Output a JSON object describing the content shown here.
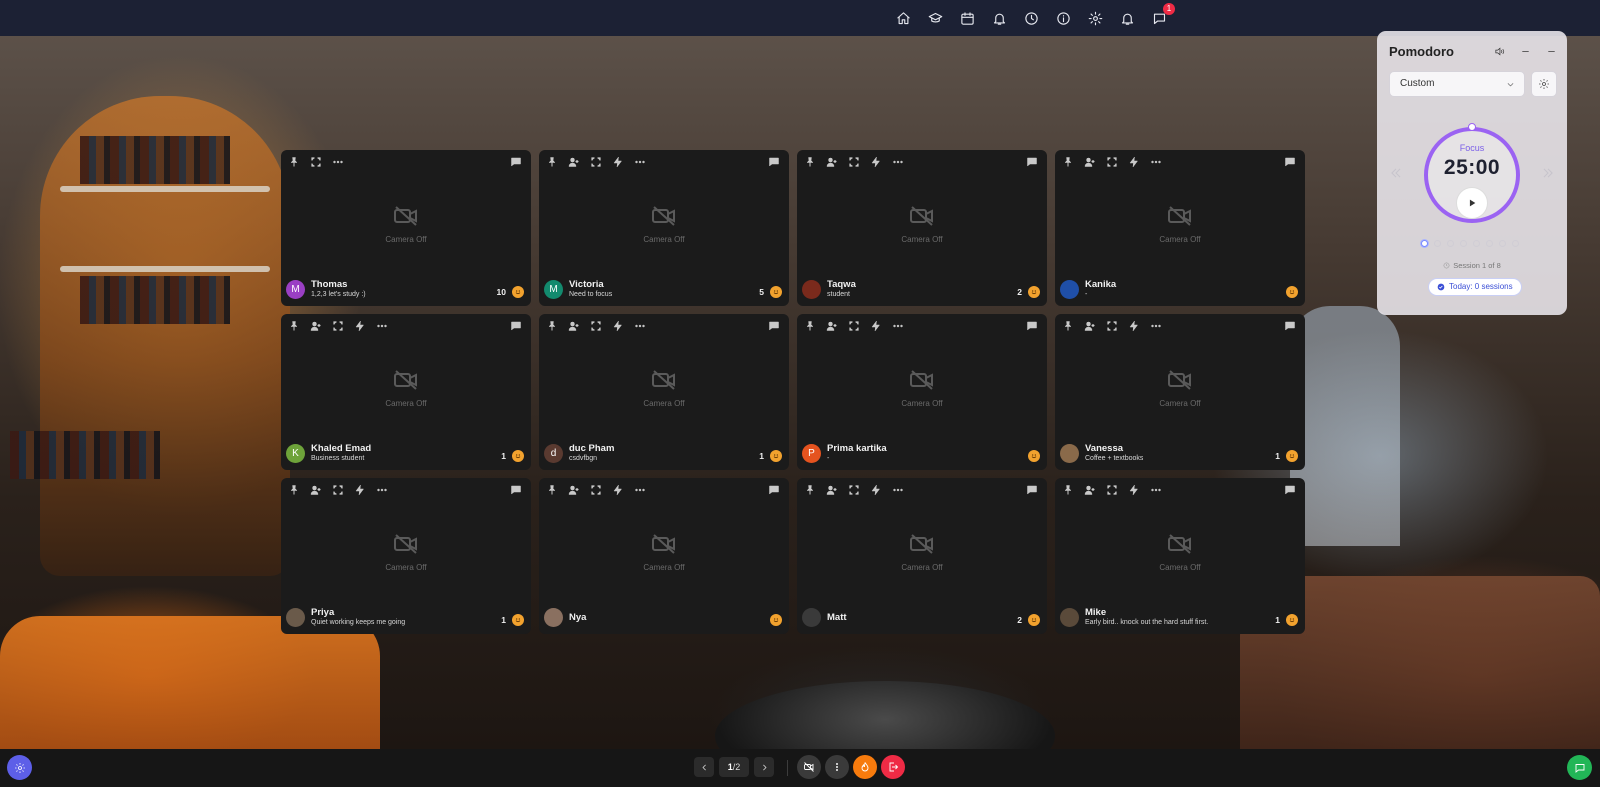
{
  "colors": {
    "topbar": "#1c2134",
    "accent_purple": "#9b63f2",
    "badge_red": "#ef2b45",
    "settings_blue": "#5d5fe8",
    "chat_green": "#22b657",
    "reaction_orange": "#f2a22e",
    "leave_red": "#ef2b45",
    "camera_orange": "#f77b0d"
  },
  "topnav": {
    "icons": [
      "home-icon",
      "graduation-cap-icon",
      "calendar-icon",
      "bell-alarm-icon",
      "clock-icon",
      "info-icon",
      "gear-icon",
      "notification-bell-icon",
      "chat-bubble-icon"
    ],
    "chat_badge": "1"
  },
  "camera_off_label": "Camera Off",
  "tiles": [
    {
      "name": "Thomas",
      "status": "1,2,3 let's study :)",
      "count": "10",
      "avatar_letter": "M",
      "avatar_color": "#9a3fc4",
      "show_add": false
    },
    {
      "name": "Victoria",
      "status": "Need to focus",
      "count": "5",
      "avatar_letter": "M",
      "avatar_color": "#138a6e",
      "show_add": true
    },
    {
      "name": "Taqwa",
      "status": "student",
      "count": "2",
      "avatar_letter": "",
      "avatar_color": "#7a2a1c",
      "show_add": true
    },
    {
      "name": "Kanika",
      "status": "-",
      "count": "",
      "avatar_letter": "",
      "avatar_color": "#1f4fa8",
      "show_add": true
    },
    {
      "name": "Khaled Emad",
      "status": "Business student",
      "count": "1",
      "avatar_letter": "K",
      "avatar_color": "#6ea33a",
      "show_add": true
    },
    {
      "name": "duc Pham",
      "status": "csdvfbgn",
      "count": "1",
      "avatar_letter": "d",
      "avatar_color": "#5a3a30",
      "show_add": true
    },
    {
      "name": "Prima kartika",
      "status": "-",
      "count": "",
      "avatar_letter": "P",
      "avatar_color": "#e5531f",
      "show_add": true
    },
    {
      "name": "Vanessa",
      "status": "Coffee + textbooks",
      "count": "1",
      "avatar_letter": "",
      "avatar_color": "#8a6a4a",
      "show_add": true
    },
    {
      "name": "Priya",
      "status": "Quiet working keeps me going",
      "count": "1",
      "avatar_letter": "",
      "avatar_color": "#6a5a4a",
      "show_add": true
    },
    {
      "name": "Nya",
      "status": "",
      "count": "",
      "avatar_letter": "",
      "avatar_color": "#8a7060",
      "show_add": true
    },
    {
      "name": "Matt",
      "status": "",
      "count": "2",
      "avatar_letter": "",
      "avatar_color": "#3a3a3a",
      "show_add": true
    },
    {
      "name": "Mike",
      "status": "Early bird.. knock out the hard stuff first.",
      "count": "1",
      "avatar_letter": "",
      "avatar_color": "#5a4a3a",
      "show_add": true
    }
  ],
  "pomodoro": {
    "title": "Pomodoro",
    "mode_selected": "Custom",
    "phase": "Focus",
    "time": "25:00",
    "session_text": "Session 1 of 8",
    "total_sessions": 8,
    "current_session": 1,
    "today_text": "Today: 0 sessions"
  },
  "pager": {
    "current": "1",
    "separator": "/",
    "total": "2"
  }
}
